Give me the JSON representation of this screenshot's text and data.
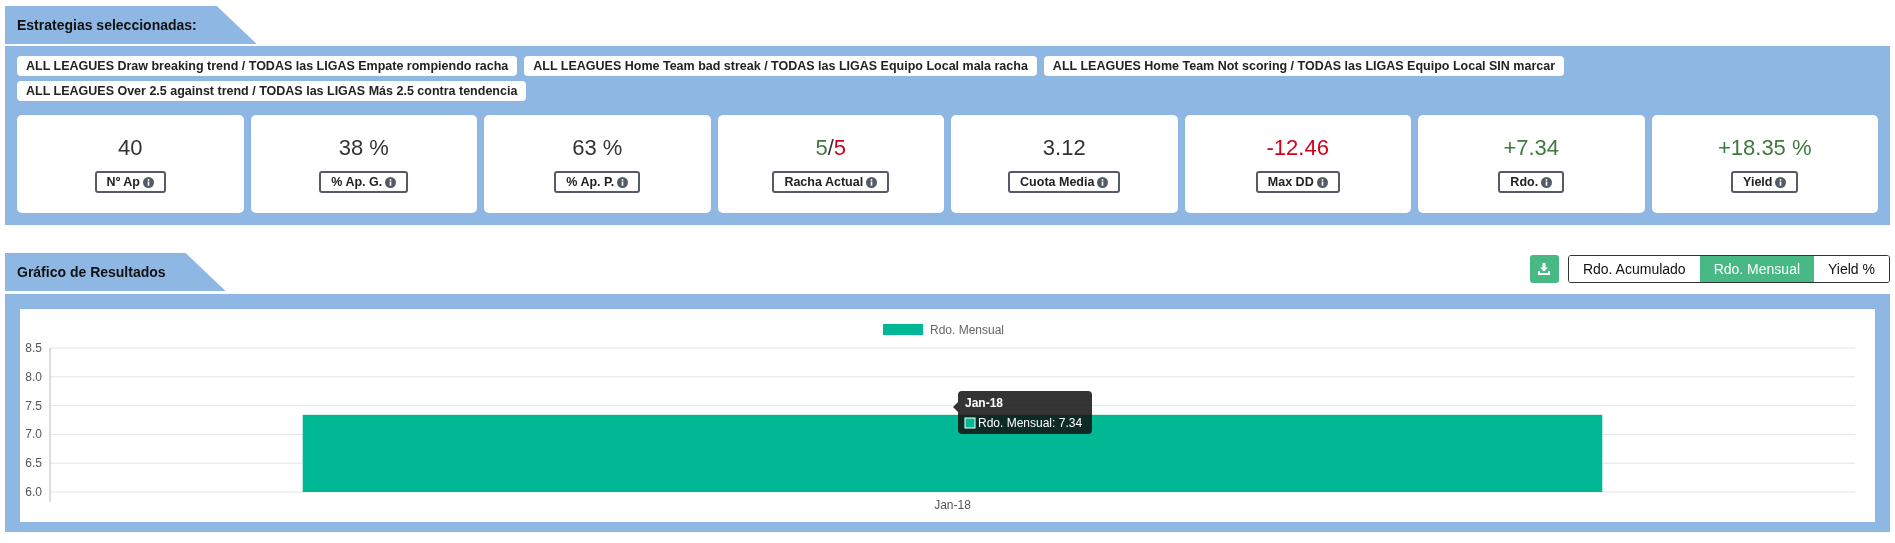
{
  "strategies_section": {
    "title": "Estrategias seleccionadas:",
    "tags": [
      "ALL LEAGUES Draw breaking trend / TODAS las LIGAS Empate rompiendo racha",
      "ALL LEAGUES Home Team bad streak / TODAS las LIGAS Equipo Local mala racha",
      "ALL LEAGUES Home Team Not scoring / TODAS las LIGAS Equipo Local SIN marcar",
      "ALL LEAGUES Over 2.5 against trend / TODAS las LIGAS Más 2.5 contra tendencia"
    ],
    "stats": [
      {
        "value_parts": [
          {
            "text": "40",
            "color": "#333333"
          }
        ],
        "label": "Nº Ap"
      },
      {
        "value_parts": [
          {
            "text": "38 %",
            "color": "#333333"
          }
        ],
        "label": "% Ap. G."
      },
      {
        "value_parts": [
          {
            "text": "63 %",
            "color": "#333333"
          }
        ],
        "label": "% Ap. P."
      },
      {
        "value_parts": [
          {
            "text": "5",
            "color": "#3d7a3d"
          },
          {
            "text": "/",
            "color": "#333333"
          },
          {
            "text": "5",
            "color": "#d0021b"
          }
        ],
        "label": "Racha Actual"
      },
      {
        "value_parts": [
          {
            "text": "3.12",
            "color": "#333333"
          }
        ],
        "label": "Cuota Media"
      },
      {
        "value_parts": [
          {
            "text": "-12.46",
            "color": "#d0021b"
          }
        ],
        "label": "Max DD"
      },
      {
        "value_parts": [
          {
            "text": "+7.34",
            "color": "#3d7a3d"
          }
        ],
        "label": "Rdo."
      },
      {
        "value_parts": [
          {
            "text": "+18.35 %",
            "color": "#3d7a3d"
          }
        ],
        "label": "Yield"
      }
    ]
  },
  "results_section": {
    "title": "Gráfico de Resultados",
    "view_options": [
      {
        "label": "Rdo. Acumulado",
        "selected": false
      },
      {
        "label": "Rdo. Mensual",
        "selected": true
      },
      {
        "label": "Yield %",
        "selected": false
      }
    ],
    "chart_data": {
      "type": "bar",
      "grid": true,
      "categories": [
        "Jan-18"
      ],
      "series": [
        {
          "name": "Rdo. Mensual",
          "color": "#00b894",
          "values": [
            7.34
          ]
        }
      ],
      "ylim": [
        6,
        8.5
      ],
      "yticks": [
        {
          "value": 6,
          "label": "6.0"
        },
        {
          "value": 6.5,
          "label": "6.5"
        },
        {
          "value": 7,
          "label": "7.0"
        },
        {
          "value": 7.5,
          "label": "7.5"
        },
        {
          "value": 8,
          "label": "8.0"
        },
        {
          "value": 8.5,
          "label": "8.5"
        }
      ]
    },
    "tooltip": {
      "title": "Jan-18",
      "text": "Rdo. Mensual: 7.34"
    }
  }
}
